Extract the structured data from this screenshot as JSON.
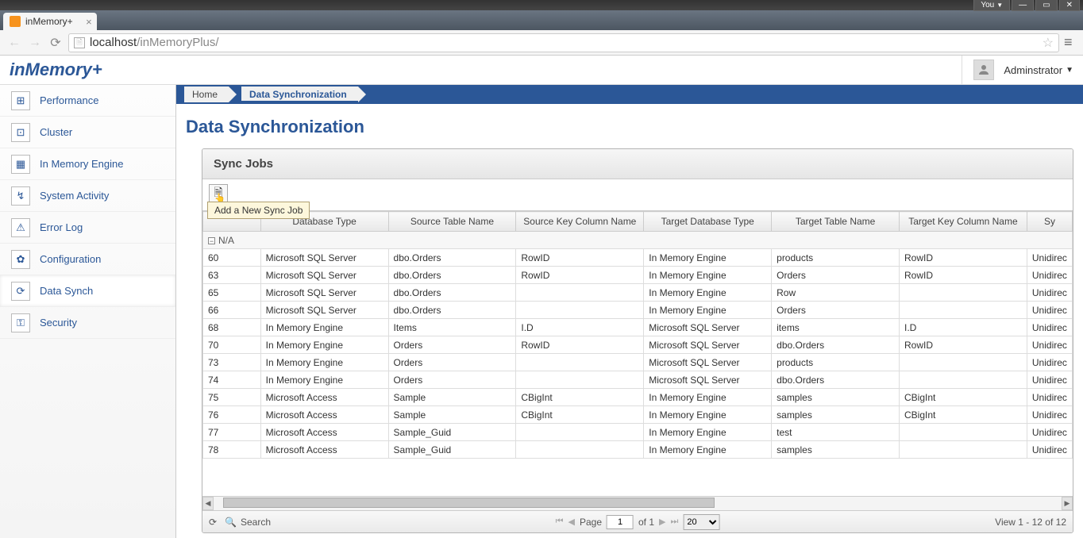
{
  "browser": {
    "tab_title": "inMemory+",
    "you_label": "You",
    "url_host": "localhost",
    "url_path": "/inMemoryPlus/"
  },
  "header": {
    "logo": "inMemory+",
    "user": "Adminstrator"
  },
  "sidebar": {
    "items": [
      {
        "icon": "⊞",
        "label": "Performance"
      },
      {
        "icon": "⊡",
        "label": "Cluster"
      },
      {
        "icon": "▦",
        "label": "In Memory Engine"
      },
      {
        "icon": "↯",
        "label": "System Activity"
      },
      {
        "icon": "⚠",
        "label": "Error Log"
      },
      {
        "icon": "✿",
        "label": "Configuration"
      },
      {
        "icon": "⟳",
        "label": "Data Synch"
      },
      {
        "icon": "⚿",
        "label": "Security"
      }
    ],
    "active_index": 6
  },
  "breadcrumb": {
    "items": [
      "Home",
      "Data Synchronization"
    ],
    "active_index": 1
  },
  "page": {
    "title": "Data Synchronization"
  },
  "panel": {
    "title": "Sync Jobs",
    "tooltip": "Add a New Sync Job"
  },
  "table": {
    "columns": [
      "",
      "Database Type",
      "Source Table Name",
      "Source Key Column Name",
      "Target Database Type",
      "Target Table Name",
      "Target Key Column Name",
      "Sy"
    ],
    "group_label": "N/A",
    "rows": [
      {
        "id": "60",
        "src_db": "Microsoft SQL Server",
        "src_tbl": "dbo.Orders",
        "src_key": "RowID",
        "tgt_db": "In Memory Engine",
        "tgt_tbl": "products",
        "tgt_key": "RowID",
        "sync": "Unidirec"
      },
      {
        "id": "63",
        "src_db": "Microsoft SQL Server",
        "src_tbl": "dbo.Orders",
        "src_key": "RowID",
        "tgt_db": "In Memory Engine",
        "tgt_tbl": "Orders",
        "tgt_key": "RowID",
        "sync": "Unidirec"
      },
      {
        "id": "65",
        "src_db": "Microsoft SQL Server",
        "src_tbl": "dbo.Orders",
        "src_key": "",
        "tgt_db": "In Memory Engine",
        "tgt_tbl": "Row",
        "tgt_key": "",
        "sync": "Unidirec"
      },
      {
        "id": "66",
        "src_db": "Microsoft SQL Server",
        "src_tbl": "dbo.Orders",
        "src_key": "",
        "tgt_db": "In Memory Engine",
        "tgt_tbl": "Orders",
        "tgt_key": "",
        "sync": "Unidirec"
      },
      {
        "id": "68",
        "src_db": "In Memory Engine",
        "src_tbl": "Items",
        "src_key": "I.D",
        "tgt_db": "Microsoft SQL Server",
        "tgt_tbl": "items",
        "tgt_key": "I.D",
        "sync": "Unidirec"
      },
      {
        "id": "70",
        "src_db": "In Memory Engine",
        "src_tbl": "Orders",
        "src_key": "RowID",
        "tgt_db": "Microsoft SQL Server",
        "tgt_tbl": "dbo.Orders",
        "tgt_key": "RowID",
        "sync": "Unidirec"
      },
      {
        "id": "73",
        "src_db": "In Memory Engine",
        "src_tbl": "Orders",
        "src_key": "",
        "tgt_db": "Microsoft SQL Server",
        "tgt_tbl": "products",
        "tgt_key": "",
        "sync": "Unidirec"
      },
      {
        "id": "74",
        "src_db": "In Memory Engine",
        "src_tbl": "Orders",
        "src_key": "",
        "tgt_db": "Microsoft SQL Server",
        "tgt_tbl": "dbo.Orders",
        "tgt_key": "",
        "sync": "Unidirec"
      },
      {
        "id": "75",
        "src_db": "Microsoft Access",
        "src_tbl": "Sample",
        "src_key": "CBigInt",
        "tgt_db": "In Memory Engine",
        "tgt_tbl": "samples",
        "tgt_key": "CBigInt",
        "sync": "Unidirec"
      },
      {
        "id": "76",
        "src_db": "Microsoft Access",
        "src_tbl": "Sample",
        "src_key": "CBigInt",
        "tgt_db": "In Memory Engine",
        "tgt_tbl": "samples",
        "tgt_key": "CBigInt",
        "sync": "Unidirec"
      },
      {
        "id": "77",
        "src_db": "Microsoft Access",
        "src_tbl": "Sample_Guid",
        "src_key": "",
        "tgt_db": "In Memory Engine",
        "tgt_tbl": "test",
        "tgt_key": "",
        "sync": "Unidirec"
      },
      {
        "id": "78",
        "src_db": "Microsoft Access",
        "src_tbl": "Sample_Guid",
        "src_key": "",
        "tgt_db": "In Memory Engine",
        "tgt_tbl": "samples",
        "tgt_key": "",
        "sync": "Unidirec"
      }
    ]
  },
  "footer": {
    "search_label": "Search",
    "page_label": "Page",
    "page_value": "1",
    "page_of": "of 1",
    "page_size": "20",
    "view_info": "View 1 - 12 of 12"
  }
}
